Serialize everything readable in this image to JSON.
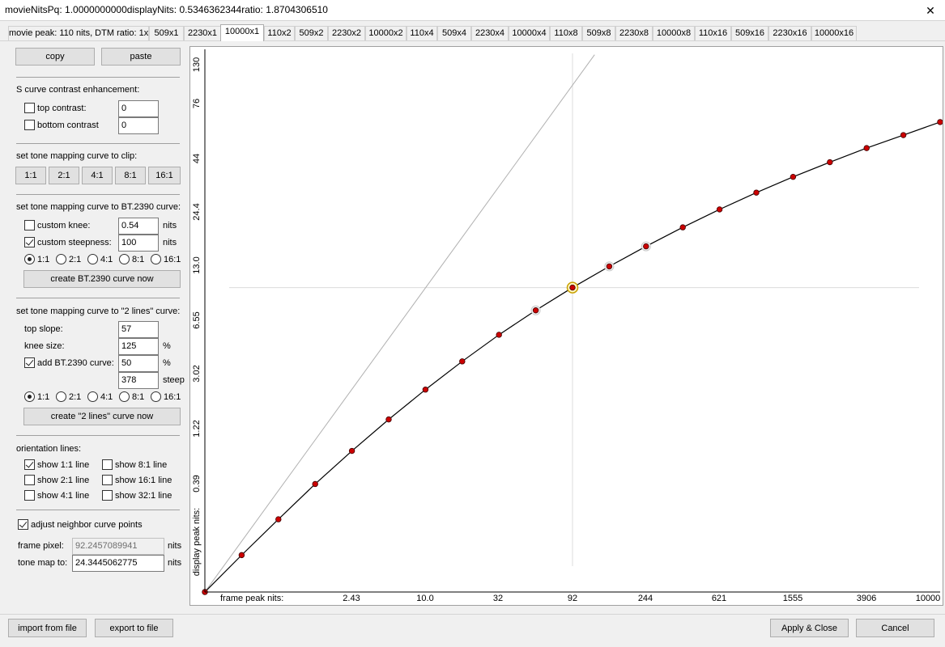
{
  "window": {
    "title": "movieNitsPq: 1.0000000000displayNits: 0.5346362344ratio: 1.8704306510",
    "close_glyph": "✕"
  },
  "tabs": [
    {
      "label": "movie peak: 110 nits, DTM ratio: 1x",
      "active": false
    },
    {
      "label": "509x1",
      "active": false
    },
    {
      "label": "2230x1",
      "active": false
    },
    {
      "label": "10000x1",
      "active": true
    },
    {
      "label": "110x2",
      "active": false
    },
    {
      "label": "509x2",
      "active": false
    },
    {
      "label": "2230x2",
      "active": false
    },
    {
      "label": "10000x2",
      "active": false
    },
    {
      "label": "110x4",
      "active": false
    },
    {
      "label": "509x4",
      "active": false
    },
    {
      "label": "2230x4",
      "active": false
    },
    {
      "label": "10000x4",
      "active": false
    },
    {
      "label": "110x8",
      "active": false
    },
    {
      "label": "509x8",
      "active": false
    },
    {
      "label": "2230x8",
      "active": false
    },
    {
      "label": "10000x8",
      "active": false
    },
    {
      "label": "110x16",
      "active": false
    },
    {
      "label": "509x16",
      "active": false
    },
    {
      "label": "2230x16",
      "active": false
    },
    {
      "label": "10000x16",
      "active": false
    }
  ],
  "left_panel": {
    "copy_label": "copy",
    "paste_label": "paste",
    "s_curve": {
      "heading": "S curve contrast enhancement:",
      "top_contrast_label": "top contrast:",
      "top_contrast_checked": false,
      "top_contrast_value": "0",
      "bottom_contrast_label": "bottom contrast",
      "bottom_contrast_checked": false,
      "bottom_contrast_value": "0"
    },
    "clip": {
      "heading": "set tone mapping curve to clip:",
      "buttons": [
        "1:1",
        "2:1",
        "4:1",
        "8:1",
        "16:1"
      ]
    },
    "bt2390": {
      "heading": "set tone mapping curve to BT.2390 curve:",
      "custom_knee_label": "custom knee:",
      "custom_knee_checked": false,
      "custom_knee_value": "0.54",
      "custom_knee_unit": "nits",
      "custom_steepness_label": "custom steepness:",
      "custom_steepness_checked": true,
      "custom_steepness_value": "100",
      "custom_steepness_unit": "nits",
      "ratios": [
        "1:1",
        "2:1",
        "4:1",
        "8:1",
        "16:1"
      ],
      "selected_ratio": "1:1",
      "create_label": "create BT.2390 curve now"
    },
    "two_lines": {
      "heading": "set tone mapping curve to \"2 lines\" curve:",
      "top_slope_label": "top slope:",
      "top_slope_value": "57",
      "knee_size_label": "knee size:",
      "knee_size_value": "125",
      "knee_size_unit": "%",
      "add_bt2390_label": "add BT.2390 curve:",
      "add_bt2390_checked": true,
      "add_bt2390_value": "50",
      "add_bt2390_unit": "%",
      "steep_value": "378",
      "steep_unit": "steep",
      "ratios": [
        "1:1",
        "2:1",
        "4:1",
        "8:1",
        "16:1"
      ],
      "selected_ratio": "1:1",
      "create_label": "create \"2 lines\" curve now"
    },
    "orientation": {
      "heading": "orientation lines:",
      "items": [
        {
          "label": "show 1:1 line",
          "checked": true
        },
        {
          "label": "show 8:1 line",
          "checked": false
        },
        {
          "label": "show 2:1 line",
          "checked": false
        },
        {
          "label": "show 16:1 line",
          "checked": false
        },
        {
          "label": "show 4:1 line",
          "checked": false
        },
        {
          "label": "show 32:1 line",
          "checked": false
        }
      ]
    },
    "adjust_neighbor_label": "adjust neighbor curve points",
    "adjust_neighbor_checked": true,
    "frame_pixel_label": "frame pixel:",
    "frame_pixel_value": "92.2457089941",
    "frame_pixel_unit": "nits",
    "tone_map_label": "tone map to:",
    "tone_map_value": "24.3445062775",
    "tone_map_unit": "nits"
  },
  "footer": {
    "import_label": "import from file",
    "export_label": "export to file",
    "apply_label": "Apply & Close",
    "cancel_label": "Cancel"
  },
  "chart_data": {
    "type": "line",
    "xlabel": "frame peak nits:",
    "ylabel": "display peak nits:",
    "x_ticks": [
      "2.43",
      "10.0",
      "32",
      "92",
      "244",
      "621",
      "1555",
      "3906",
      "10000"
    ],
    "y_ticks": [
      "130",
      "76",
      "44",
      "24.4",
      "13.0",
      "6.55",
      "3.02",
      "1.22",
      "0.39"
    ],
    "curve_points_pq": [
      [
        0.0,
        0.0
      ],
      [
        0.05,
        0.068
      ],
      [
        0.1,
        0.134
      ],
      [
        0.15,
        0.199
      ],
      [
        0.2,
        0.26
      ],
      [
        0.25,
        0.318
      ],
      [
        0.3,
        0.373
      ],
      [
        0.35,
        0.425
      ],
      [
        0.4,
        0.474
      ],
      [
        0.45,
        0.519
      ],
      [
        0.5,
        0.561
      ],
      [
        0.55,
        0.6
      ],
      [
        0.6,
        0.637
      ],
      [
        0.65,
        0.672
      ],
      [
        0.7,
        0.705
      ],
      [
        0.75,
        0.736
      ],
      [
        0.8,
        0.765
      ],
      [
        0.85,
        0.792
      ],
      [
        0.9,
        0.818
      ],
      [
        0.95,
        0.842
      ],
      [
        1.0,
        0.866
      ]
    ],
    "highlighted_points": [
      9,
      10,
      11,
      12
    ],
    "selected_point": 10,
    "reference_line": "1:1",
    "colors": {
      "curve": "#000000",
      "point": "#cc0000",
      "selected_ring": "#c8a000",
      "reference": "#b0b0b0",
      "crosshair": "#dcdcdc"
    }
  }
}
